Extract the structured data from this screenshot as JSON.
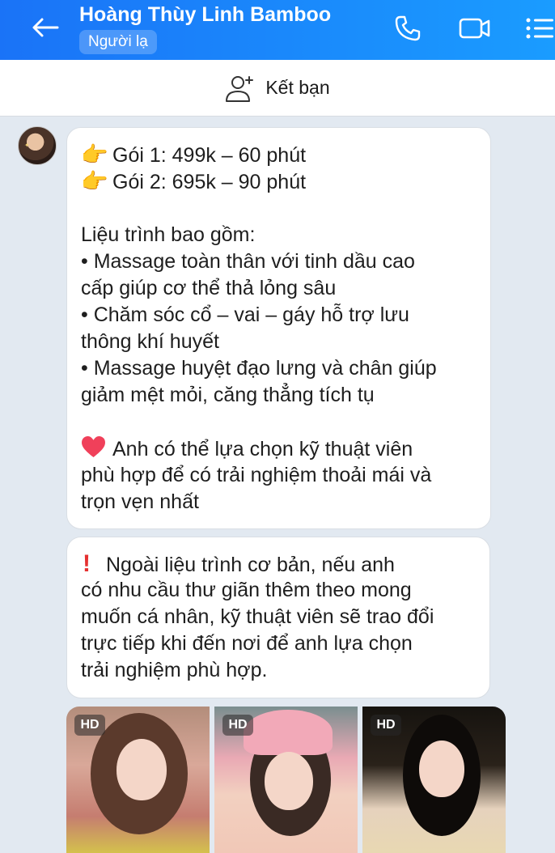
{
  "header": {
    "title": "Hoàng Thùy Linh Bamboo",
    "badge": "Người lạ"
  },
  "add_friend": {
    "label": "Kết bạn"
  },
  "messages": [
    {
      "lines": [
        "Gói 1: 499k – 60 phút",
        "Gói 2: 695k – 90 phút",
        "",
        "Liệu trình bao gồm:",
        " • Massage toàn thân với tinh dầu cao",
        "cấp giúp cơ thể thả lỏng sâu",
        " • Chăm sóc cổ – vai – gáy hỗ trợ lưu",
        "thông khí huyết",
        " • Massage huyệt đạo lưng và chân giúp",
        "giảm mệt mỏi, căng thẳng tích tụ",
        "",
        "Anh có thể lựa chọn kỹ thuật viên",
        "phù hợp để có trải nghiệm thoải mái và",
        "trọn vẹn nhất"
      ]
    },
    {
      "lines": [
        "Ngoài liệu trình cơ bản, nếu anh",
        "có nhu cầu thư giãn thêm theo mong",
        "muốn cá nhân, kỹ thuật viên sẽ trao đổi",
        "trực tiếp khi đến nơi để anh lựa chọn",
        "trải nghiệm phù hợp."
      ]
    }
  ],
  "photos": [
    {
      "badge": "HD"
    },
    {
      "badge": "HD"
    },
    {
      "badge": "HD"
    }
  ],
  "icons": {
    "back": "arrow-left-icon",
    "call": "phone-icon",
    "video": "video-camera-icon",
    "menu": "list-menu-icon",
    "add_friend": "add-person-icon",
    "pointing": "backhand-index-pointing-right-emoji",
    "heart": "red-heart-emoji",
    "exclamation": "red-exclamation-emoji"
  },
  "colors": {
    "header_start": "#1a73f7",
    "header_end": "#1a9cff",
    "chat_background": "#e2e9f1",
    "bubble": "#ffffff"
  }
}
